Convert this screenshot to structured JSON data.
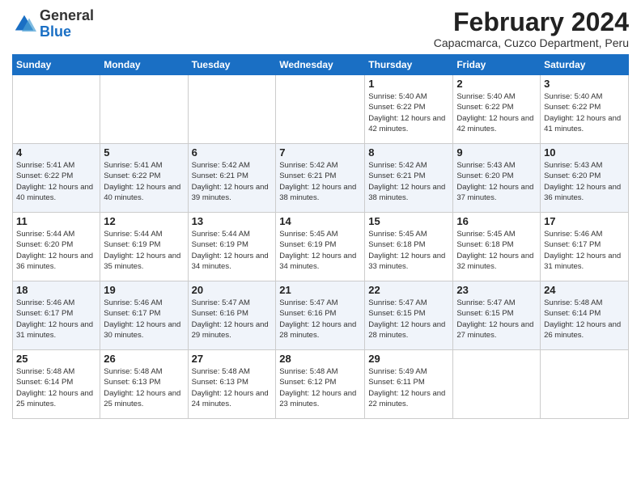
{
  "logo": {
    "general": "General",
    "blue": "Blue"
  },
  "title": "February 2024",
  "subtitle": "Capacmarca, Cuzco Department, Peru",
  "days": [
    "Sunday",
    "Monday",
    "Tuesday",
    "Wednesday",
    "Thursday",
    "Friday",
    "Saturday"
  ],
  "weeks": [
    [
      {
        "day": "",
        "info": ""
      },
      {
        "day": "",
        "info": ""
      },
      {
        "day": "",
        "info": ""
      },
      {
        "day": "",
        "info": ""
      },
      {
        "day": "1",
        "info": "Sunrise: 5:40 AM\nSunset: 6:22 PM\nDaylight: 12 hours and 42 minutes."
      },
      {
        "day": "2",
        "info": "Sunrise: 5:40 AM\nSunset: 6:22 PM\nDaylight: 12 hours and 42 minutes."
      },
      {
        "day": "3",
        "info": "Sunrise: 5:40 AM\nSunset: 6:22 PM\nDaylight: 12 hours and 41 minutes."
      }
    ],
    [
      {
        "day": "4",
        "info": "Sunrise: 5:41 AM\nSunset: 6:22 PM\nDaylight: 12 hours and 40 minutes."
      },
      {
        "day": "5",
        "info": "Sunrise: 5:41 AM\nSunset: 6:22 PM\nDaylight: 12 hours and 40 minutes."
      },
      {
        "day": "6",
        "info": "Sunrise: 5:42 AM\nSunset: 6:21 PM\nDaylight: 12 hours and 39 minutes."
      },
      {
        "day": "7",
        "info": "Sunrise: 5:42 AM\nSunset: 6:21 PM\nDaylight: 12 hours and 38 minutes."
      },
      {
        "day": "8",
        "info": "Sunrise: 5:42 AM\nSunset: 6:21 PM\nDaylight: 12 hours and 38 minutes."
      },
      {
        "day": "9",
        "info": "Sunrise: 5:43 AM\nSunset: 6:20 PM\nDaylight: 12 hours and 37 minutes."
      },
      {
        "day": "10",
        "info": "Sunrise: 5:43 AM\nSunset: 6:20 PM\nDaylight: 12 hours and 36 minutes."
      }
    ],
    [
      {
        "day": "11",
        "info": "Sunrise: 5:44 AM\nSunset: 6:20 PM\nDaylight: 12 hours and 36 minutes."
      },
      {
        "day": "12",
        "info": "Sunrise: 5:44 AM\nSunset: 6:19 PM\nDaylight: 12 hours and 35 minutes."
      },
      {
        "day": "13",
        "info": "Sunrise: 5:44 AM\nSunset: 6:19 PM\nDaylight: 12 hours and 34 minutes."
      },
      {
        "day": "14",
        "info": "Sunrise: 5:45 AM\nSunset: 6:19 PM\nDaylight: 12 hours and 34 minutes."
      },
      {
        "day": "15",
        "info": "Sunrise: 5:45 AM\nSunset: 6:18 PM\nDaylight: 12 hours and 33 minutes."
      },
      {
        "day": "16",
        "info": "Sunrise: 5:45 AM\nSunset: 6:18 PM\nDaylight: 12 hours and 32 minutes."
      },
      {
        "day": "17",
        "info": "Sunrise: 5:46 AM\nSunset: 6:17 PM\nDaylight: 12 hours and 31 minutes."
      }
    ],
    [
      {
        "day": "18",
        "info": "Sunrise: 5:46 AM\nSunset: 6:17 PM\nDaylight: 12 hours and 31 minutes."
      },
      {
        "day": "19",
        "info": "Sunrise: 5:46 AM\nSunset: 6:17 PM\nDaylight: 12 hours and 30 minutes."
      },
      {
        "day": "20",
        "info": "Sunrise: 5:47 AM\nSunset: 6:16 PM\nDaylight: 12 hours and 29 minutes."
      },
      {
        "day": "21",
        "info": "Sunrise: 5:47 AM\nSunset: 6:16 PM\nDaylight: 12 hours and 28 minutes."
      },
      {
        "day": "22",
        "info": "Sunrise: 5:47 AM\nSunset: 6:15 PM\nDaylight: 12 hours and 28 minutes."
      },
      {
        "day": "23",
        "info": "Sunrise: 5:47 AM\nSunset: 6:15 PM\nDaylight: 12 hours and 27 minutes."
      },
      {
        "day": "24",
        "info": "Sunrise: 5:48 AM\nSunset: 6:14 PM\nDaylight: 12 hours and 26 minutes."
      }
    ],
    [
      {
        "day": "25",
        "info": "Sunrise: 5:48 AM\nSunset: 6:14 PM\nDaylight: 12 hours and 25 minutes."
      },
      {
        "day": "26",
        "info": "Sunrise: 5:48 AM\nSunset: 6:13 PM\nDaylight: 12 hours and 25 minutes."
      },
      {
        "day": "27",
        "info": "Sunrise: 5:48 AM\nSunset: 6:13 PM\nDaylight: 12 hours and 24 minutes."
      },
      {
        "day": "28",
        "info": "Sunrise: 5:48 AM\nSunset: 6:12 PM\nDaylight: 12 hours and 23 minutes."
      },
      {
        "day": "29",
        "info": "Sunrise: 5:49 AM\nSunset: 6:11 PM\nDaylight: 12 hours and 22 minutes."
      },
      {
        "day": "",
        "info": ""
      },
      {
        "day": "",
        "info": ""
      }
    ]
  ]
}
